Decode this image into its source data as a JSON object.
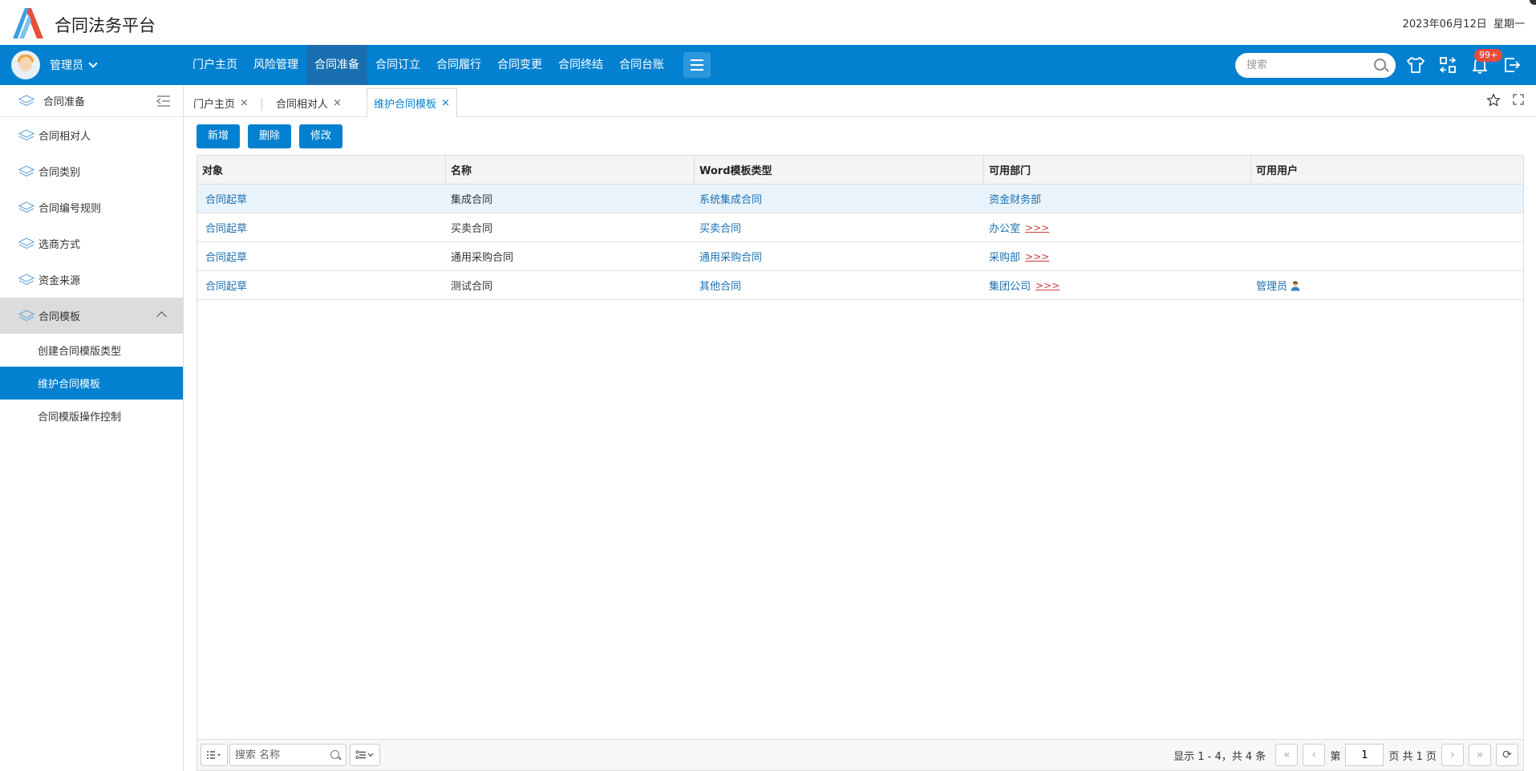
{
  "header": {
    "app_title": "合同法务平台",
    "date": "2023年06月12日",
    "weekday": "星期一"
  },
  "navbar": {
    "user_name": "管理员",
    "menu": [
      "门户主页",
      "风险管理",
      "合同准备",
      "合同订立",
      "合同履行",
      "合同变更",
      "合同终结",
      "合同台账"
    ],
    "active_index": 2,
    "search_placeholder": "搜索",
    "notification_badge": "99+"
  },
  "sidebar": {
    "title": "合同准备",
    "items": [
      "合同相对人",
      "合同类别",
      "合同编号规则",
      "选商方式",
      "资金来源",
      "合同模板"
    ],
    "open_item": "合同模板",
    "sub_items": [
      "创建合同模版类型",
      "维护合同模板",
      "合同模版操作控制"
    ],
    "active_sub": "维护合同模板"
  },
  "tabs": [
    {
      "label": "门户主页",
      "close": "×"
    },
    {
      "label": "合同相对人",
      "close": "×"
    },
    {
      "label": "维护合同模板",
      "close": "×"
    }
  ],
  "toolbar": {
    "add_label": "新增",
    "delete_label": "删除",
    "edit_label": "修改"
  },
  "grid": {
    "columns": [
      "对象",
      "名称",
      "Word模板类型",
      "可用部门",
      "可用用户"
    ],
    "rows": [
      {
        "object": "合同起草",
        "name": "集成合同",
        "word_type": "系统集成合同",
        "dept": "资金财务部",
        "dept_more": "",
        "user": ""
      },
      {
        "object": "合同起草",
        "name": "买卖合同",
        "word_type": "买卖合同",
        "dept": "办公室",
        "dept_more": ">>>",
        "user": ""
      },
      {
        "object": "合同起草",
        "name": "通用采购合同",
        "word_type": "通用采购合同",
        "dept": "采购部",
        "dept_more": ">>>",
        "user": ""
      },
      {
        "object": "合同起草",
        "name": "测试合同",
        "word_type": "其他合同",
        "dept": "集团公司",
        "dept_more": ">>>",
        "user": "管理员"
      }
    ]
  },
  "pager": {
    "search_placeholder": "搜索 名称",
    "summary": "显示 1 - 4，共 4 条",
    "page_prefix": "第",
    "page_value": "1",
    "page_suffix": "页 共 1 页"
  }
}
